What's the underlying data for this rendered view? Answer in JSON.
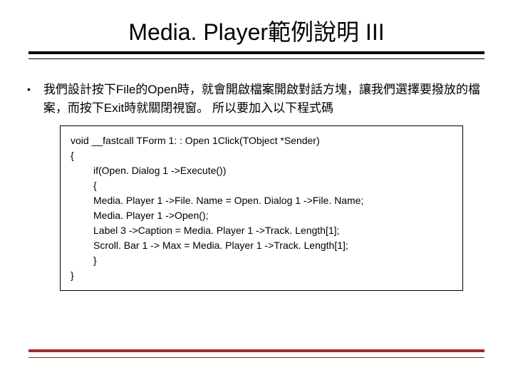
{
  "slide": {
    "title": "Media. Player範例說明 III",
    "bullet_text": "我們設計按下File的Open時，就會開啟檔案開啟對話方塊，讓我們選擇要撥放的檔案，而按下Exit時就關閉視窗。 所以要加入以下程式碼",
    "code": {
      "l0": "void __fastcall TForm 1: : Open 1Click(TObject *Sender)",
      "l1": "{",
      "l2": "if(Open. Dialog 1 ->Execute())",
      "l3": "{",
      "l4": "Media. Player 1 ->File. Name = Open. Dialog 1 ->File. Name;",
      "l5": "Media. Player 1 ->Open();",
      "l6": "Label 3 ->Caption = Media. Player 1 ->Track. Length[1];",
      "l7": "Scroll. Bar 1 -> Max = Media. Player 1 ->Track. Length[1];",
      "l8": "}",
      "l9": "}"
    }
  }
}
